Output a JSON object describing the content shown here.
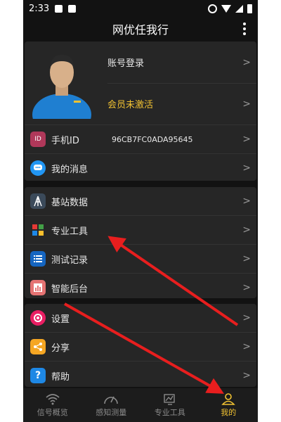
{
  "status_bar": {
    "time": "2:33"
  },
  "app": {
    "title": "网优任我行"
  },
  "profile": {
    "login_label": "账号登录",
    "member_status": "会员未激活"
  },
  "account_rows": [
    {
      "label": "手机ID",
      "value": "96CB7FC0ADA95645",
      "icon": "id-icon",
      "icon_text": "ID"
    },
    {
      "label": "我的消息",
      "icon": "message-icon"
    }
  ],
  "tools_rows": [
    {
      "label": "基站数据",
      "icon": "base-station-icon"
    },
    {
      "label": "专业工具",
      "icon": "tools-grid-icon"
    },
    {
      "label": "测试记录",
      "icon": "list-icon"
    },
    {
      "label": "智能后台",
      "icon": "chart-icon"
    }
  ],
  "misc_rows": [
    {
      "label": "设置",
      "icon": "settings-icon"
    },
    {
      "label": "分享",
      "icon": "share-icon"
    },
    {
      "label": "帮助",
      "icon": "help-icon",
      "icon_text": "?"
    }
  ],
  "tabs": [
    {
      "label": "信号概览",
      "icon": "wifi-signal-icon"
    },
    {
      "label": "感知测量",
      "icon": "gauge-icon"
    },
    {
      "label": "专业工具",
      "icon": "tool-chart-icon"
    },
    {
      "label": "我的",
      "icon": "person-icon",
      "active": true
    }
  ],
  "colors": {
    "accent": "#f1c232",
    "background": "#121212",
    "card": "#262626",
    "arrow": "#e81e1e"
  }
}
